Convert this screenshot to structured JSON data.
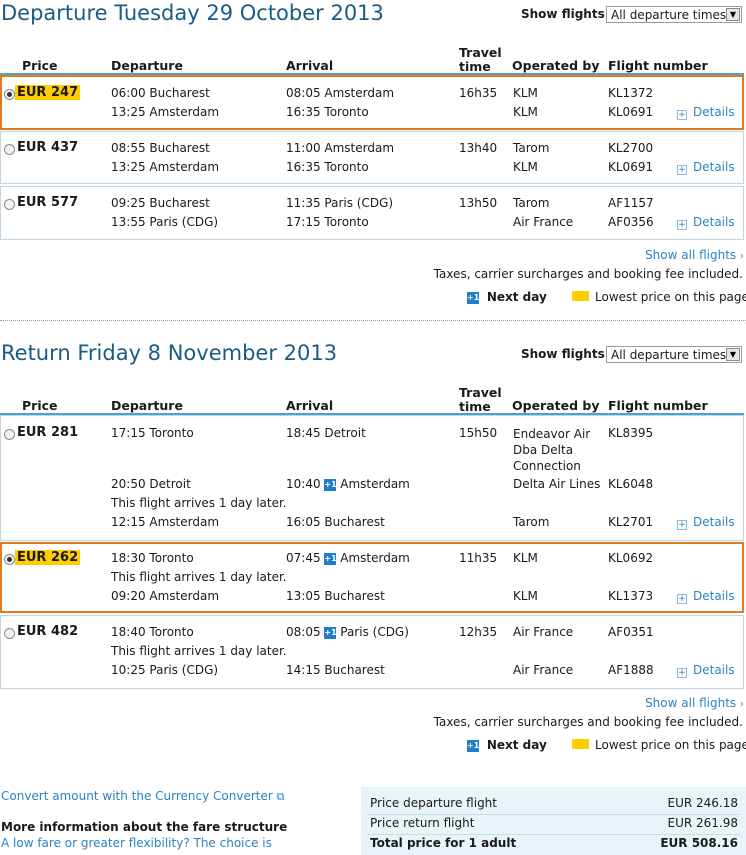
{
  "departure": {
    "title": "Departure Tuesday 29 October 2013",
    "show_flights_label": "Show flights",
    "show_flights_value": "All departure times",
    "headers": {
      "price": "Price",
      "departure": "Departure",
      "arrival": "Arrival",
      "travel_time_1": "Travel",
      "travel_time_2": "time",
      "operated_by": "Operated by",
      "flight_number": "Flight number"
    },
    "options": [
      {
        "price": "EUR 247",
        "selected": true,
        "lowest": true,
        "time": "16h35",
        "legs": [
          {
            "dep": "06:00 Bucharest",
            "arr": "08:05 Amsterdam",
            "op": "KLM",
            "fn": "KL1372"
          },
          {
            "dep": "13:25 Amsterdam",
            "arr": "16:35 Toronto",
            "op": "KLM",
            "fn": "KL0691"
          }
        ]
      },
      {
        "price": "EUR 437",
        "selected": false,
        "lowest": false,
        "time": "13h40",
        "legs": [
          {
            "dep": "08:55 Bucharest",
            "arr": "11:00 Amsterdam",
            "op": "Tarom",
            "fn": "KL2700"
          },
          {
            "dep": "13:25 Amsterdam",
            "arr": "16:35 Toronto",
            "op": "KLM",
            "fn": "KL0691"
          }
        ]
      },
      {
        "price": "EUR 577",
        "selected": false,
        "lowest": false,
        "time": "13h50",
        "legs": [
          {
            "dep": "09:25 Bucharest",
            "arr": "11:35 Paris (CDG)",
            "op": "Tarom",
            "fn": "AF1157"
          },
          {
            "dep": "13:55 Paris (CDG)",
            "arr": "17:15 Toronto",
            "op": "Air France",
            "fn": "AF0356"
          }
        ]
      }
    ],
    "details_label": "Details",
    "show_all": "Show all flights",
    "taxes_note": "Taxes, carrier surcharges and booking fee included.",
    "next_day_icon": "+1",
    "next_day_label": "Next day",
    "lowest_label": "Lowest price on this page"
  },
  "return": {
    "title": "Return Friday 8 November 2013",
    "show_flights_label": "Show flights",
    "show_flights_value": "All departure times",
    "headers": {
      "price": "Price",
      "departure": "Departure",
      "arrival": "Arrival",
      "travel_time_1": "Travel",
      "travel_time_2": "time",
      "operated_by": "Operated by",
      "flight_number": "Flight number"
    },
    "opt1": {
      "price": "EUR 281",
      "time": "15h50",
      "l1": {
        "dep": "17:15 Toronto",
        "arr": "18:45 Detroit",
        "op1": "Endeavor Air",
        "op2": "Dba Delta",
        "op3": "Connection",
        "fn": "KL8395"
      },
      "l2": {
        "dep": "20:50 Detroit",
        "arr_time": "10:40",
        "arr_city": "Amsterdam",
        "op": "Delta Air Lines",
        "fn": "KL6048"
      },
      "l2_note": "This flight arrives 1 day later.",
      "l3": {
        "dep": "12:15 Amsterdam",
        "arr": "16:05 Bucharest",
        "op": "Tarom",
        "fn": "KL2701"
      }
    },
    "opt2": {
      "price": "EUR 262",
      "time": "11h35",
      "l1": {
        "dep": "18:30 Toronto",
        "arr_time": "07:45",
        "arr_city": "Amsterdam",
        "op": "KLM",
        "fn": "KL0692"
      },
      "l1_note": "This flight arrives 1 day later.",
      "l2": {
        "dep": "09:20 Amsterdam",
        "arr": "13:05 Bucharest",
        "op": "KLM",
        "fn": "KL1373"
      }
    },
    "opt3": {
      "price": "EUR 482",
      "time": "12h35",
      "l1": {
        "dep": "18:40 Toronto",
        "arr_time": "08:05",
        "arr_city": "Paris (CDG)",
        "op": "Air France",
        "fn": "AF0351"
      },
      "l1_note": "This flight arrives 1 day later.",
      "l2": {
        "dep": "10:25 Paris (CDG)",
        "arr": "14:15 Bucharest",
        "op": "Air France",
        "fn": "AF1888"
      }
    },
    "details_label": "Details",
    "show_all": "Show all flights",
    "taxes_note": "Taxes, carrier surcharges and booking fee included.",
    "next_day_icon": "+1",
    "next_day_label": "Next day",
    "lowest_label": "Lowest price on this page"
  },
  "footer": {
    "currency_link": "Convert amount with the Currency Converter",
    "fare_heading": "More information about the fare structure",
    "fare_text": "A low fare or greater flexibility? The choice is",
    "summary": {
      "dep_label": "Price departure flight",
      "dep_value": "EUR 246.18",
      "ret_label": "Price return flight",
      "ret_value": "EUR 261.98",
      "total_label": "Total price for 1 adult",
      "total_value": "EUR 508.16"
    }
  },
  "colors": {
    "accent": "#1a5b85",
    "link": "#2a83c4",
    "highlight": "#ffcc00",
    "selected_border": "#e07a22"
  }
}
